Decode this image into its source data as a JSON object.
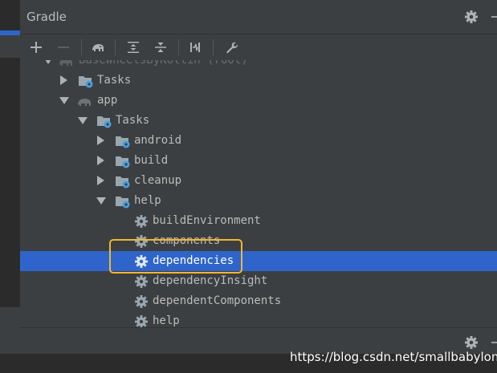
{
  "panel": {
    "title": "Gradle"
  },
  "toolbar": [
    {
      "name": "add-icon"
    },
    {
      "name": "remove-icon"
    },
    {
      "name": "elephant-icon"
    },
    {
      "name": "expand-all-icon"
    },
    {
      "name": "collapse-all-icon"
    },
    {
      "name": "toggle-offline-icon"
    },
    {
      "name": "wrench-icon"
    }
  ],
  "tree": [
    {
      "label": "BaseWheelsByKotlin (root)",
      "faded": true
    },
    {
      "label": "Tasks"
    },
    {
      "label": "app"
    },
    {
      "label": "Tasks"
    },
    {
      "label": "android"
    },
    {
      "label": "build"
    },
    {
      "label": "cleanup"
    },
    {
      "label": "help"
    },
    {
      "label": "buildEnvironment"
    },
    {
      "label": "components"
    },
    {
      "label": "dependencies",
      "selected": true
    },
    {
      "label": "dependencyInsight"
    },
    {
      "label": "dependentComponents"
    },
    {
      "label": "help"
    }
  ],
  "watermark": "https://blog.csdn.net/smallbabylong",
  "colors": {
    "selection": "#2f65ca",
    "highlight_box": "#f2b632",
    "panel_bg": "#3c3f41",
    "folder_gear": "#4a9fe0"
  }
}
